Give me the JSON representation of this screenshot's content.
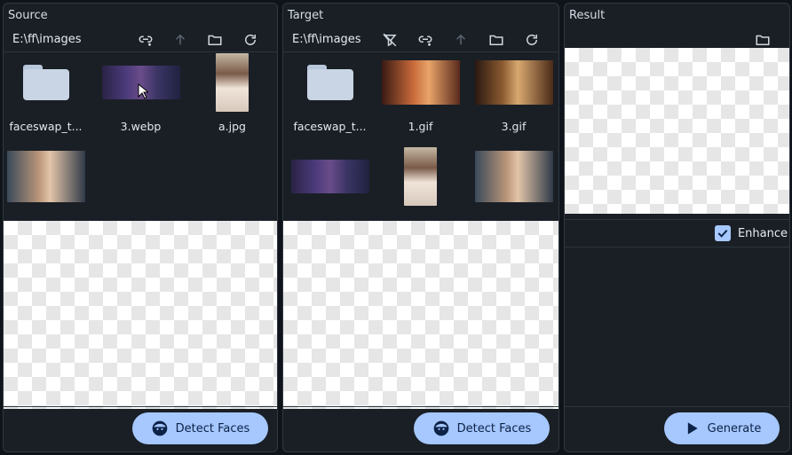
{
  "panels": {
    "source": {
      "title": "Source",
      "path": "E:\\ff\\images",
      "items": [
        {
          "label": "faceswap_t...",
          "kind": "folder"
        },
        {
          "label": "3.webp",
          "kind": "image"
        },
        {
          "label": "a.jpg",
          "kind": "image"
        },
        {
          "label": "",
          "kind": "image"
        }
      ],
      "button": "Detect Faces"
    },
    "target": {
      "title": "Target",
      "path": "E:\\ff\\images",
      "items": [
        {
          "label": "faceswap_t...",
          "kind": "folder"
        },
        {
          "label": "1.gif",
          "kind": "image"
        },
        {
          "label": "3.gif",
          "kind": "image"
        },
        {
          "label": "",
          "kind": "image"
        },
        {
          "label": "",
          "kind": "image"
        },
        {
          "label": "",
          "kind": "image"
        }
      ],
      "button": "Detect Faces"
    },
    "result": {
      "title": "Result",
      "enhance_label": "Enhance",
      "enhance_checked": true,
      "button": "Generate"
    }
  },
  "icons": {
    "toolbar": [
      "link-icon",
      "filter-off-icon",
      "up-arrow-icon",
      "folder-icon",
      "refresh-icon"
    ],
    "button": [
      "face-icon",
      "play-icon"
    ]
  },
  "colors": {
    "accent": "#a6c8ff",
    "panel_bg": "#1a1f26",
    "page_bg": "#0f141a"
  }
}
